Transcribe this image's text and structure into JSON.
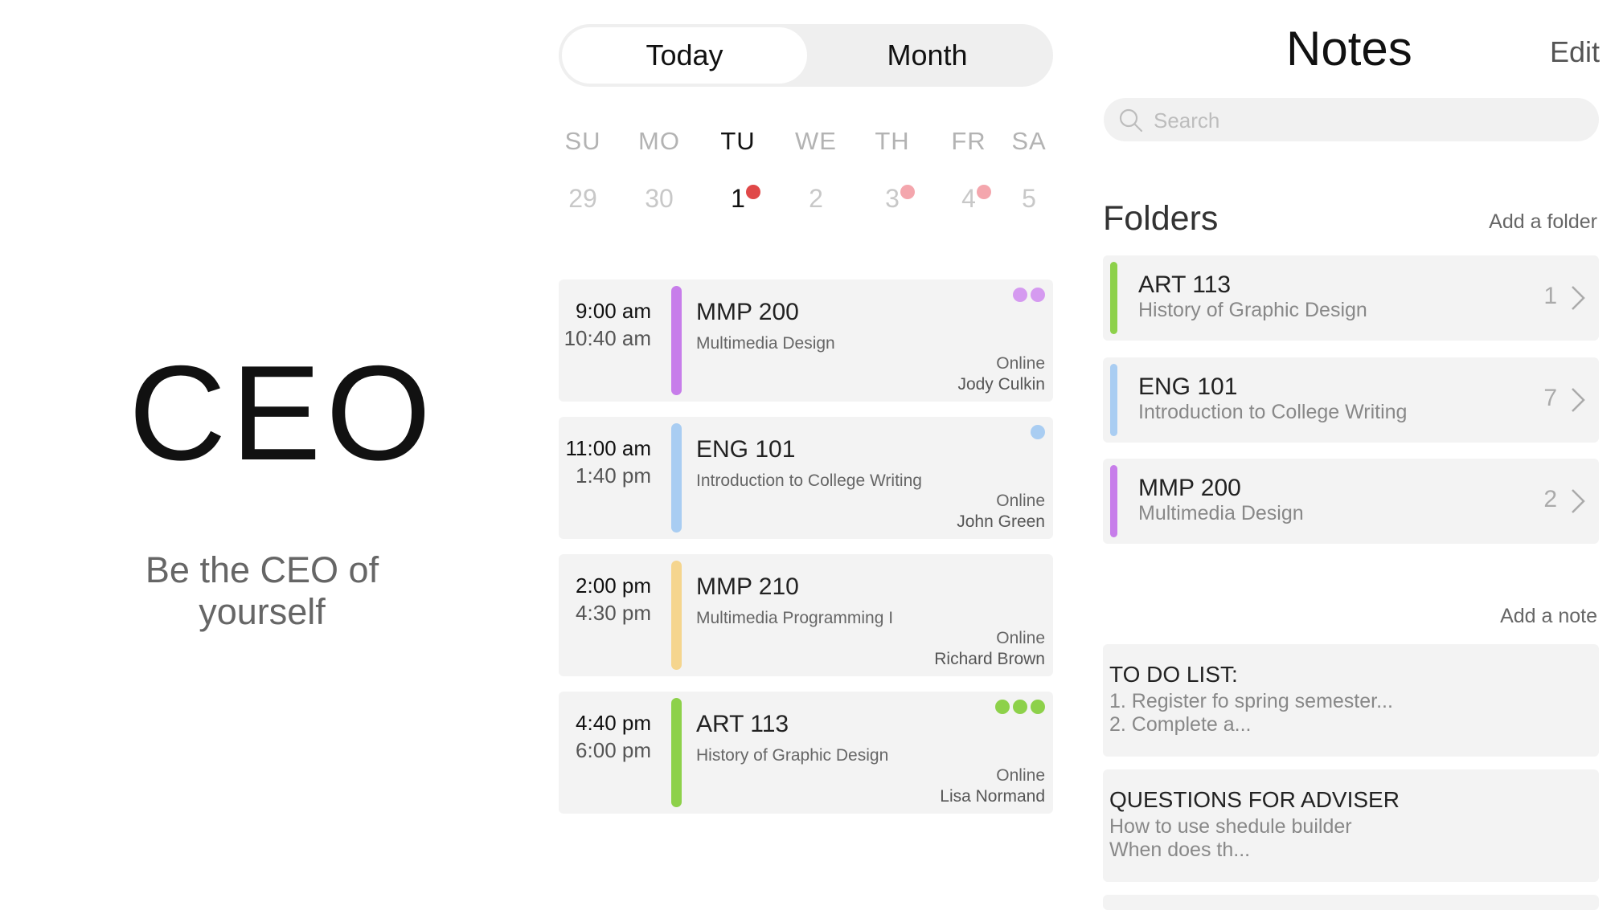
{
  "brand": {
    "title": "CEO",
    "tagline": "Be the CEO of yourself"
  },
  "schedule": {
    "toggle": {
      "today_label": "Today",
      "month_label": "Month",
      "selected": "Today"
    },
    "week": [
      {
        "dayname": "SU",
        "date": "29",
        "today": false,
        "dot": null
      },
      {
        "dayname": "MO",
        "date": "30",
        "today": false,
        "dot": null
      },
      {
        "dayname": "TU",
        "date": "1",
        "today": true,
        "dot": "#e04848"
      },
      {
        "dayname": "WE",
        "date": "2",
        "today": false,
        "dot": null
      },
      {
        "dayname": "TH",
        "date": "3",
        "today": false,
        "dot": "#f4a6ad"
      },
      {
        "dayname": "FR",
        "date": "4",
        "today": false,
        "dot": "#f4a6ad"
      },
      {
        "dayname": "SA",
        "date": "5",
        "today": false,
        "dot": null
      }
    ],
    "classes": [
      {
        "start": "9:00 am",
        "end": "10:40 am",
        "code": "MMP 200",
        "name": "Multimedia Design",
        "mode": "Online",
        "instructor": "Jody Culkin",
        "color": "#c77dea",
        "dots": [
          "#d59af0",
          "#d59af0"
        ]
      },
      {
        "start": "11:00 am",
        "end": "1:40 pm",
        "code": "ENG 101",
        "name": "Introduction to College Writing",
        "mode": "Online",
        "instructor": "John Green",
        "color": "#a9cdf2",
        "dots": [
          "#a9cdf2"
        ]
      },
      {
        "start": "2:00 pm",
        "end": "4:30 pm",
        "code": "MMP 210",
        "name": "Multimedia Programming I",
        "mode": "Online",
        "instructor": "Richard Brown",
        "color": "#f5d58e",
        "dots": []
      },
      {
        "start": "4:40 pm",
        "end": "6:00 pm",
        "code": "ART 113",
        "name": "History of Graphic Design",
        "mode": "Online",
        "instructor": "Lisa Normand",
        "color": "#8dd14a",
        "dots": [
          "#8dd14a",
          "#8dd14a",
          "#8dd14a"
        ]
      }
    ]
  },
  "notes": {
    "title": "Notes",
    "edit_label": "Edit",
    "search_placeholder": "Search",
    "folders_heading": "Folders",
    "add_folder_label": "Add a folder",
    "folders": [
      {
        "code": "ART 113",
        "name": "History of Graphic Design",
        "count": "1",
        "color": "#8dd14a"
      },
      {
        "code": "ENG 101",
        "name": "Introduction to College Writing",
        "count": "7",
        "color": "#a9cdf2"
      },
      {
        "code": "MMP 200",
        "name": "Multimedia Design",
        "count": "2",
        "color": "#c77dea"
      }
    ],
    "add_note_label": "Add a note",
    "notes": [
      {
        "title": "TO DO LIST:",
        "line1": "1. Register fo spring semester...",
        "line2": "2. Complete a..."
      },
      {
        "title": "QUESTIONS FOR ADVISER",
        "line1": "How to use shedule builder",
        "line2": "When does th..."
      }
    ]
  }
}
